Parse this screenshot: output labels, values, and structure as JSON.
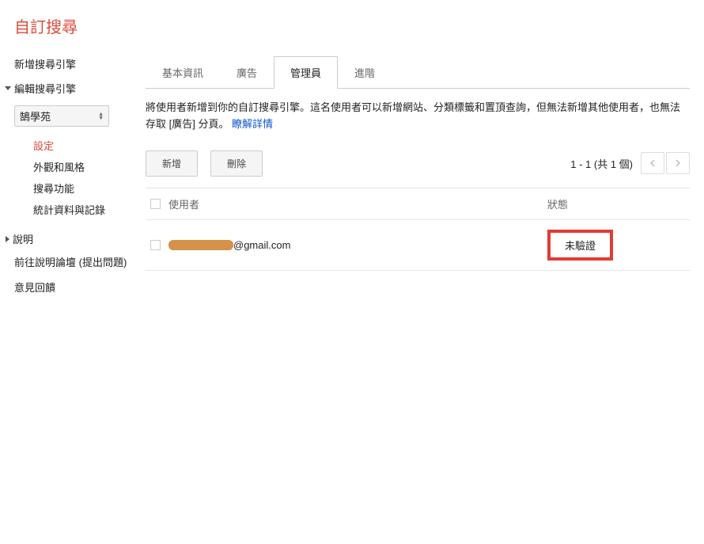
{
  "header": {
    "title": "自訂搜尋"
  },
  "sidebar": {
    "add_engine": "新增搜尋引擎",
    "edit_engine": "編輯搜尋引擎",
    "selected_engine": "鵠學苑",
    "sub_items": {
      "settings": "設定",
      "appearance": "外觀和風格",
      "search_features": "搜尋功能",
      "statistics": "統計資料與記錄"
    },
    "help": "說明",
    "forum": "前往說明論壇 (提出問題)",
    "feedback": "意見回饋"
  },
  "tabs": {
    "basic": "基本資訊",
    "ads": "廣告",
    "admins": "管理員",
    "advanced": "進階"
  },
  "description": {
    "text": "將使用者新增到你的自訂搜尋引擎。這名使用者可以新增網站、分類標籤和置頂查詢，但無法新增其他使用者，也無法存取 [廣告] 分頁。",
    "link_text": "瞭解詳情"
  },
  "toolbar": {
    "add_label": "新增",
    "delete_label": "刪除"
  },
  "pagination": {
    "text": "1 - 1 (共 1 個)"
  },
  "table": {
    "header_user": "使用者",
    "header_status": "狀態",
    "rows": [
      {
        "email_suffix": "@gmail.com",
        "status": "未驗證"
      }
    ]
  }
}
